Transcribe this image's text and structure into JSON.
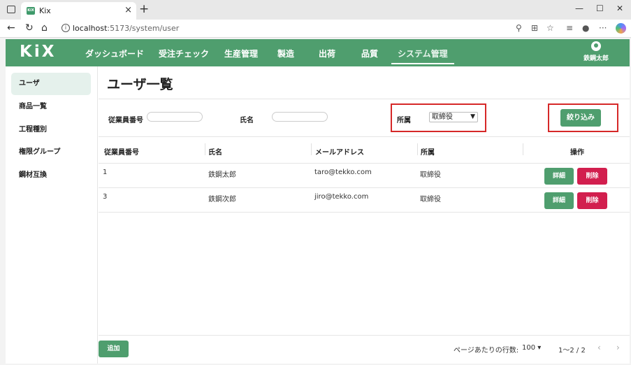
{
  "browser": {
    "tab_title": "Kix",
    "favicon_text": "KiX",
    "url_host": "localhost",
    "url_path": ":5173/system/user"
  },
  "app": {
    "logo": "KiX",
    "nav": [
      "ダッシュボード",
      "受注チェック",
      "生産管理",
      "製造",
      "出荷",
      "品質",
      "システム管理"
    ],
    "active_nav": "システム管理",
    "user_name": "鉄鋼太郎",
    "brand_color": "#4f9e6e",
    "danger_color": "#d21f4e"
  },
  "sidebar": {
    "items": [
      "ユーザ",
      "商品一覧",
      "工程種別",
      "権限グループ",
      "鋼材互換"
    ],
    "active": "ユーザ"
  },
  "page": {
    "title": "ユーザ一覧"
  },
  "filters": {
    "employee_no_label": "従業員番号",
    "employee_no_value": "",
    "name_label": "氏名",
    "name_value": "",
    "affiliation_label": "所属",
    "affiliation_selected": "取締役",
    "submit_label": "絞り込み"
  },
  "table": {
    "headers": [
      "従業員番号",
      "氏名",
      "メールアドレス",
      "所属",
      "操作"
    ],
    "rows": [
      {
        "employee_no": "1",
        "name": "鉄鋼太郎",
        "email": "taro@tekko.com",
        "affiliation": "取締役",
        "detail": "詳細",
        "delete": "削除"
      },
      {
        "employee_no": "3",
        "name": "鉄鋼次郎",
        "email": "jiro@tekko.com",
        "affiliation": "取締役",
        "detail": "詳細",
        "delete": "削除"
      }
    ]
  },
  "footer": {
    "add_label": "追加",
    "rows_per_page_label": "ページあたりの行数:",
    "rows_per_page_value": "100",
    "range": "1〜2 / 2"
  },
  "icons": {
    "window": "window-icon",
    "back": "back-arrow-icon",
    "reload": "reload-icon",
    "home": "home-icon",
    "info": "site-info-icon",
    "user": "user-icon"
  }
}
